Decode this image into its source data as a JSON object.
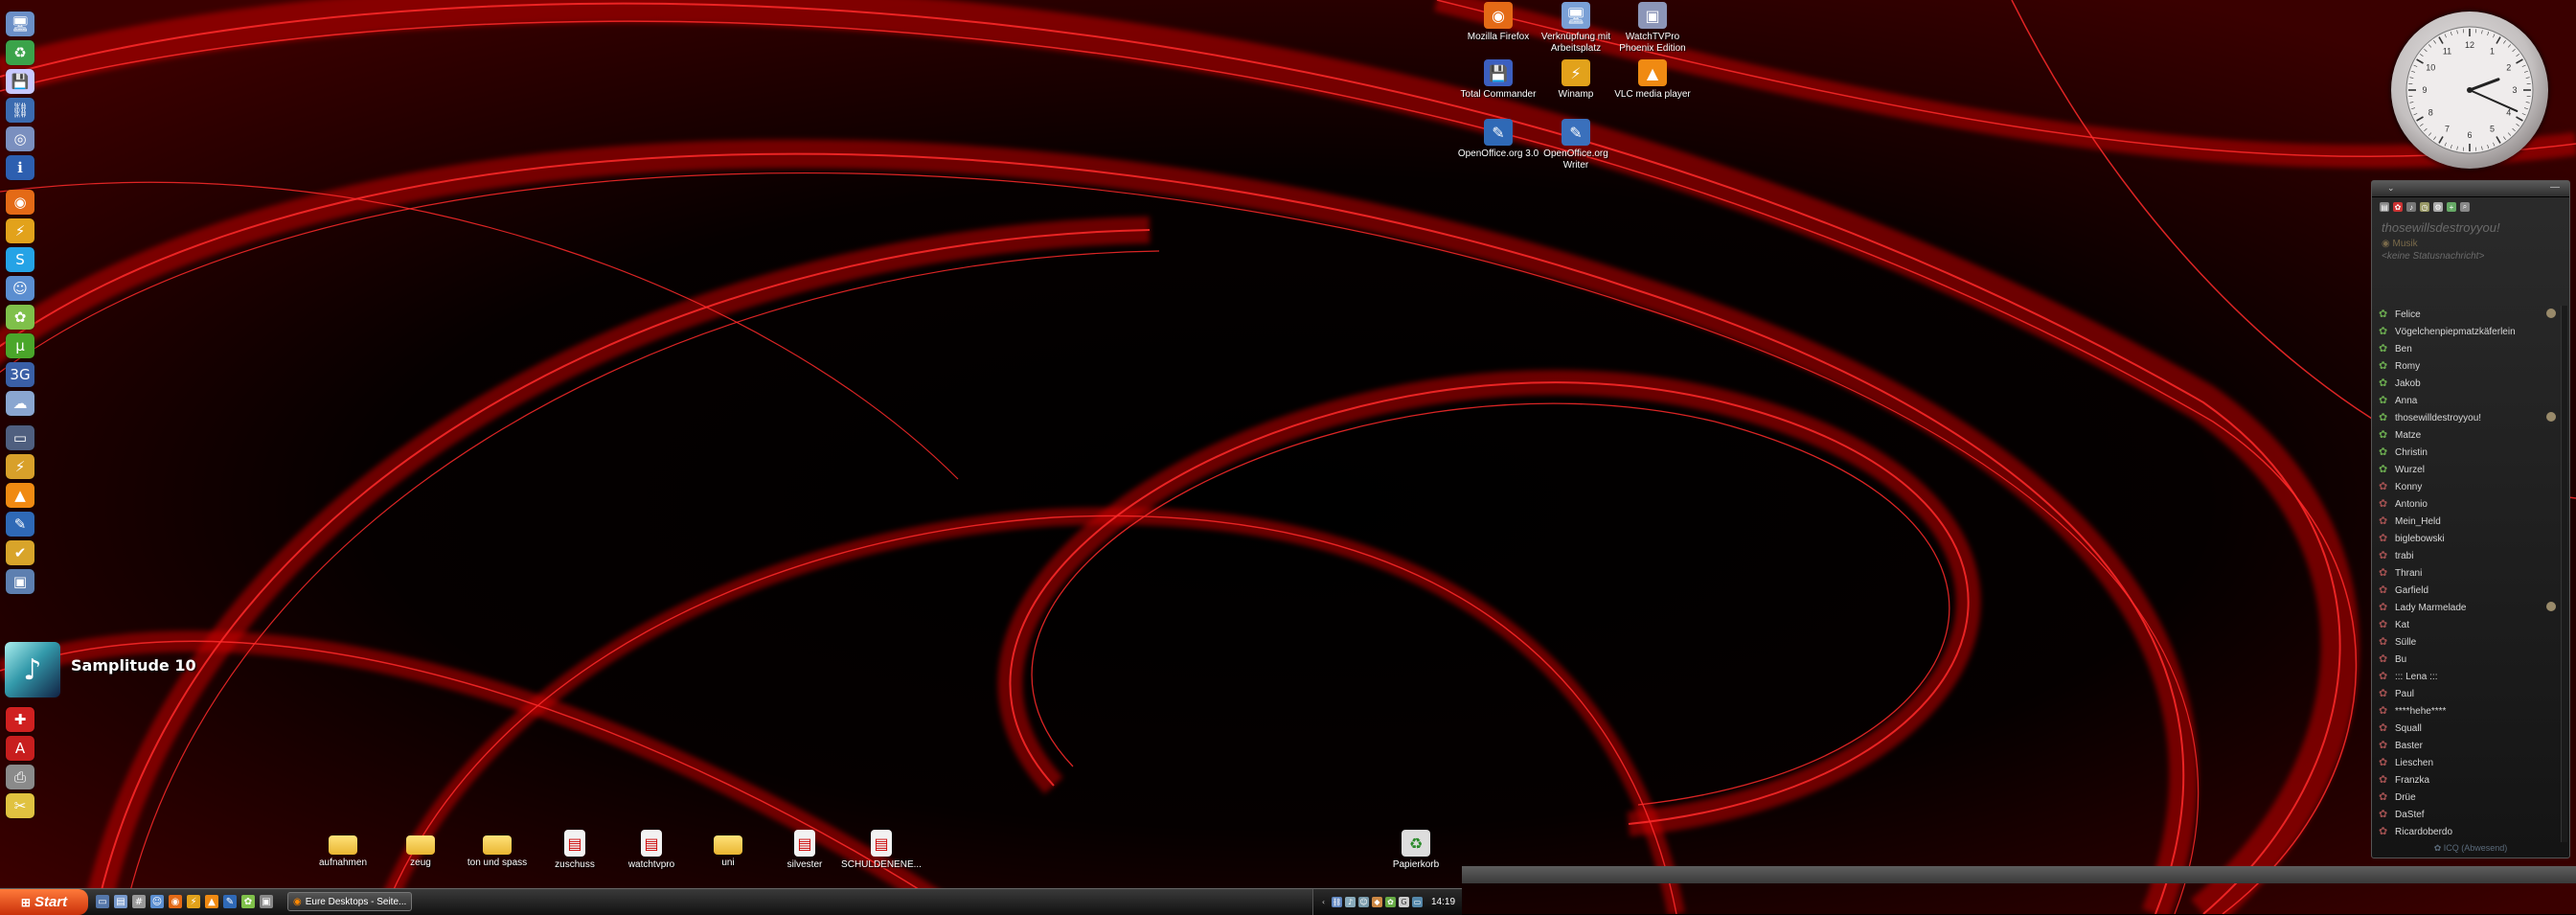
{
  "dock": {
    "big_app_label": "Samplitude 10",
    "icons": [
      {
        "icon": "computer-icon",
        "color": "#6b8fc7",
        "glyph": "🖥"
      },
      {
        "icon": "recycle-icon",
        "color": "#3ba34a",
        "glyph": "♻"
      },
      {
        "icon": "disk-icon",
        "color": "#c8c8ff",
        "glyph": "💾"
      },
      {
        "icon": "network-icon",
        "color": "#3b6bb0",
        "glyph": "⛓"
      },
      {
        "icon": "globe-icon",
        "color": "#7a8fbf",
        "glyph": "◎"
      },
      {
        "icon": "info-icon",
        "color": "#2d5fb0",
        "glyph": "ℹ"
      },
      {
        "icon": "firefox-icon",
        "color": "#e46a16",
        "glyph": "◉"
      },
      {
        "icon": "winamp-icon",
        "color": "#e2a21b",
        "glyph": "⚡"
      },
      {
        "icon": "skype-icon",
        "color": "#25a3e6",
        "glyph": "S"
      },
      {
        "icon": "messenger-icon",
        "color": "#5b8ed0",
        "glyph": "☺"
      },
      {
        "icon": "icq-icon",
        "color": "#7fc04a",
        "glyph": "✿"
      },
      {
        "icon": "utorrent-icon",
        "color": "#4aa62a",
        "glyph": "µ"
      },
      {
        "icon": "3g-icon",
        "color": "#3a5fa6",
        "glyph": "3G"
      },
      {
        "icon": "chat-icon",
        "color": "#8aa6d0",
        "glyph": "☁"
      },
      {
        "icon": "monitor-icon",
        "color": "#4f5f7f",
        "glyph": "▭"
      },
      {
        "icon": "winamp-icon",
        "color": "#d8a02a",
        "glyph": "⚡"
      },
      {
        "icon": "vlc-icon",
        "color": "#f08a12",
        "glyph": "▲"
      },
      {
        "icon": "openoffice-icon",
        "color": "#2f69b6",
        "glyph": "✎"
      },
      {
        "icon": "checkmark-icon",
        "color": "#d8a42a",
        "glyph": "✔"
      },
      {
        "icon": "window-icon",
        "color": "#5d7fb0",
        "glyph": "▣"
      },
      {
        "icon": "cross-icon",
        "color": "#d02020",
        "glyph": "✚"
      },
      {
        "icon": "acrobat-icon",
        "color": "#c81e1e",
        "glyph": "A"
      },
      {
        "icon": "printer-icon",
        "color": "#8a8a8a",
        "glyph": "⎙"
      },
      {
        "icon": "tools-icon",
        "color": "#e0c240",
        "glyph": "✂"
      }
    ]
  },
  "desktop_icons_top": [
    {
      "label": "Mozilla Firefox",
      "icon": "firefox-icon",
      "glyph": "◉",
      "color": "#e46a16"
    },
    {
      "label": "Verknüpfung mit Arbeitsplatz",
      "icon": "computer-icon",
      "glyph": "🖥",
      "color": "#7aa0d6"
    },
    {
      "label": "WatchTVPro Phoenix Edition",
      "icon": "tv-icon",
      "glyph": "▣",
      "color": "#8c96b8"
    },
    {
      "label": "Total Commander",
      "icon": "floppy-icon",
      "glyph": "💾",
      "color": "#3c5fc0"
    },
    {
      "label": "Winamp",
      "icon": "winamp-icon",
      "glyph": "⚡",
      "color": "#e2a21b"
    },
    {
      "label": "VLC media player",
      "icon": "vlc-icon",
      "glyph": "▲",
      "color": "#f08a12"
    },
    {
      "label": "OpenOffice.org 3.0",
      "icon": "openoffice-icon",
      "glyph": "✎",
      "color": "#2f69b6"
    },
    {
      "label": "OpenOffice.org Writer",
      "icon": "writer-icon",
      "glyph": "✎",
      "color": "#3a70bc"
    }
  ],
  "desktop_icons_bottom": [
    {
      "label": "aufnahmen",
      "icon": "folder-icon",
      "kind": "folder"
    },
    {
      "label": "zeug",
      "icon": "folder-icon",
      "kind": "folder"
    },
    {
      "label": "ton und spass",
      "icon": "folder-icon",
      "kind": "folder"
    },
    {
      "label": "zuschuss",
      "icon": "pdf-icon",
      "kind": "doc"
    },
    {
      "label": "watchtvpro",
      "icon": "pdf-icon",
      "kind": "doc"
    },
    {
      "label": "uni",
      "icon": "folder-icon",
      "kind": "folder"
    },
    {
      "label": "silvester",
      "icon": "document-icon",
      "kind": "doc"
    },
    {
      "label": "SCHULDENENE...",
      "icon": "document-icon",
      "kind": "doc"
    },
    {
      "label": "Papierkorb",
      "icon": "trash-icon",
      "kind": "trash"
    }
  ],
  "messenger": {
    "nickname": "thosewillsdestroyyou!",
    "mood": "Musik",
    "status_message": "<keine Statusnachricht>",
    "footer": "ICQ (Abwesend)",
    "contacts": [
      {
        "name": "Felice",
        "status": "online",
        "extra": true
      },
      {
        "name": "Vögelchenpiepmatzkäferlein",
        "status": "online"
      },
      {
        "name": "Ben",
        "status": "online"
      },
      {
        "name": "Romy",
        "status": "online"
      },
      {
        "name": "Jakob",
        "status": "online"
      },
      {
        "name": "Anna",
        "status": "online"
      },
      {
        "name": "thosewilldestroyyou!",
        "status": "online",
        "extra": true
      },
      {
        "name": "Matze",
        "status": "online"
      },
      {
        "name": "Christin",
        "status": "online"
      },
      {
        "name": "Wurzel",
        "status": "online"
      },
      {
        "name": "Konny",
        "status": "offline"
      },
      {
        "name": "Antonio",
        "status": "offline"
      },
      {
        "name": "Mein_Held",
        "status": "offline"
      },
      {
        "name": "biglebowski",
        "status": "offline"
      },
      {
        "name": "trabi",
        "status": "offline"
      },
      {
        "name": "Thrani",
        "status": "offline"
      },
      {
        "name": "Garfield",
        "status": "offline"
      },
      {
        "name": "Lady Marmelade",
        "status": "offline",
        "extra": true
      },
      {
        "name": "Kat",
        "status": "offline"
      },
      {
        "name": "Sülle",
        "status": "offline"
      },
      {
        "name": "Bu",
        "status": "offline"
      },
      {
        "name": "::: Lena :::",
        "status": "offline"
      },
      {
        "name": "Paul",
        "status": "offline"
      },
      {
        "name": "****hehe****",
        "status": "offline"
      },
      {
        "name": "Squall",
        "status": "offline"
      },
      {
        "name": "Baster",
        "status": "offline"
      },
      {
        "name": "Lieschen",
        "status": "offline"
      },
      {
        "name": "Franzka",
        "status": "offline"
      },
      {
        "name": "Drüe",
        "status": "offline"
      },
      {
        "name": "DaStef",
        "status": "offline"
      },
      {
        "name": "Ricardoberdo",
        "status": "offline"
      }
    ]
  },
  "clock": {
    "hour": 2,
    "minute": 19
  },
  "taskbar": {
    "start_label": "Start",
    "active_task": "Eure Desktops - Seite...",
    "time": "14:19"
  },
  "colors": {
    "accent": "#e01010",
    "online": "#6aa84f",
    "offline": "#a05050"
  }
}
